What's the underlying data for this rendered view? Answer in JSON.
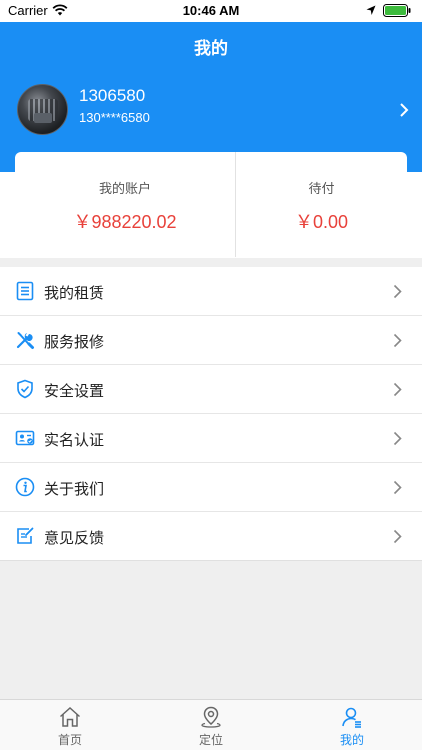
{
  "status_bar": {
    "carrier": "Carrier",
    "time": "10:46 AM"
  },
  "header": {
    "title": "我的",
    "username": "1306580",
    "phone": "130****6580"
  },
  "account": {
    "balance_label": "我的账户",
    "balance_value": "￥988220.02",
    "pending_label": "待付",
    "pending_value": "￥0.00"
  },
  "menu": {
    "items": [
      {
        "label": "我的租赁",
        "icon": "list-document-icon"
      },
      {
        "label": "服务报修",
        "icon": "wrench-screwdriver-icon"
      },
      {
        "label": "安全设置",
        "icon": "shield-check-icon"
      },
      {
        "label": "实名认证",
        "icon": "id-card-icon"
      },
      {
        "label": "关于我们",
        "icon": "info-icon"
      },
      {
        "label": "意见反馈",
        "icon": "edit-feedback-icon"
      }
    ]
  },
  "tabbar": {
    "tabs": [
      {
        "label": "首页",
        "icon": "home-icon"
      },
      {
        "label": "定位",
        "icon": "location-pin-icon"
      },
      {
        "label": "我的",
        "icon": "profile-icon",
        "active": true
      }
    ]
  },
  "colors": {
    "primary": "#1a8ef4",
    "money": "#e8413a",
    "background": "#efefef"
  }
}
